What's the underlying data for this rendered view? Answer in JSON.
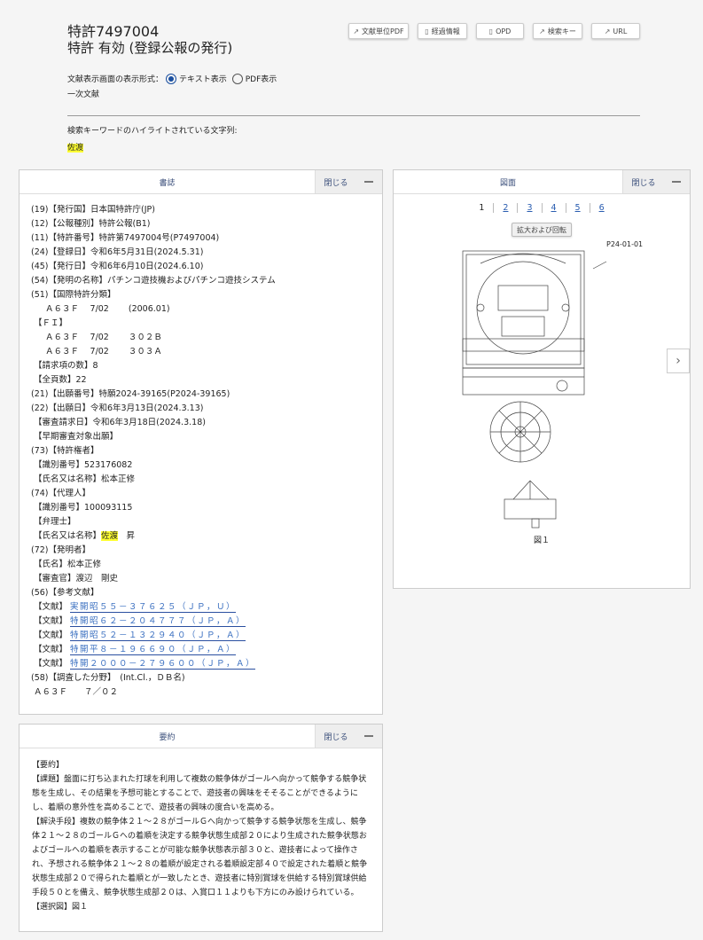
{
  "header": {
    "patent_no": "特許7497004",
    "status": "特許 有効 (登録公報の発行)"
  },
  "toolbar": [
    {
      "label": "文献単位PDF",
      "icon": "external-link-icon"
    },
    {
      "label": "経過情報",
      "icon": "document-icon"
    },
    {
      "label": "OPD",
      "icon": "document-icon"
    },
    {
      "label": "検索キー",
      "icon": "external-link-icon"
    },
    {
      "label": "URL",
      "icon": "external-link-icon"
    }
  ],
  "display_format": {
    "label": "文献表示画面の表示形式：",
    "options": [
      "テキスト表示",
      "PDF表示"
    ],
    "selected": "テキスト表示"
  },
  "primary_doc": "一次文献",
  "keyword": {
    "label": "検索キーワードのハイライトされている文字列:",
    "value": "佐渡"
  },
  "biblio": {
    "title": "書誌",
    "close": "閉じる",
    "lines": [
      "(19)【発行国】日本国特許庁(JP)",
      "(12)【公報種別】特許公報(B1)",
      "(11)【特許番号】特許第7497004号(P7497004)",
      "(24)【登録日】令和6年5月31日(2024.5.31)",
      "(45)【発行日】令和6年6月10日(2024.6.10)",
      "(54)【発明の名称】パチンコ遊技機およびパチンコ遊技システム",
      "(51)【国際特許分類】",
      "Ａ６３Ｆ　 7/02　　 (2006.01)",
      "【ＦＩ】",
      "Ａ６３Ｆ　 7/02　　 ３０２Ｂ",
      "Ａ６３Ｆ　 7/02　　 ３０３Ａ",
      "【請求項の数】8",
      "【全頁数】22",
      "(21)【出願番号】特願2024-39165(P2024-39165)",
      "(22)【出願日】令和6年3月13日(2024.3.13)",
      "【審査請求日】令和6年3月18日(2024.3.18)",
      "【早期審査対象出願】",
      "(73)【特許権者】",
      "【識別番号】523176082",
      "【氏名又は名称】松本正修",
      "(74)【代理人】",
      "【識別番号】100093115",
      "【弁理士】"
    ],
    "agent_name_label": "【氏名又は名称】",
    "agent_name_hl": "佐渡",
    "agent_name_rest": "昇",
    "lines2": [
      "(72)【発明者】",
      "【氏名】松本正修",
      "【審査官】渡辺　剛史",
      "(56)【参考文献】"
    ],
    "ref_label": "【文献】",
    "refs": [
      "実開昭５５－３７６２５（ＪＰ，Ｕ）",
      "特開昭６２－２０４７７７（ＪＰ，Ａ）",
      "特開昭５２－１３２９４０（ＪＰ，Ａ）",
      "特開平８－１９６６９０（ＪＰ，Ａ）",
      "特開２０００－２７９６００（ＪＰ，Ａ）"
    ],
    "lines3": [
      "(58)【調査した分野】　(Int.Cl.，ＤＢ名)",
      "Ａ６３Ｆ　　７／０２"
    ]
  },
  "drawings": {
    "title": "図面",
    "close": "閉じる",
    "pages": [
      "1",
      "2",
      "3",
      "4",
      "5",
      "6"
    ],
    "current_page": "1",
    "zoom_button": "拡大および回転",
    "fig_id": "P24-01-01",
    "caption": "図１"
  },
  "abstract": {
    "title": "要約",
    "close": "閉じる",
    "paras": [
      "【要約】",
      "【課題】盤面に打ち込まれた打球を利用して複数の競争体がゴールへ向かって競争する競争状態を生成し、その結果を予想可能とすることで、遊技者の興味をそそることができるようにし、着順の意外性を高めることで、遊技者の興味の度合いを高める。",
      "【解決手段】複数の競争体２１～２８がゴールＧへ向かって競争する競争状態を生成し、競争体２１～２８のゴールＧへの着順を決定する競争状態生成部２０により生成された競争状態およびゴールへの着順を表示することが可能な競争状態表示部３０と、遊技者によって操作され、予想される競争体２１～２８の着順が設定される着順設定部４０で設定された着順と競争状態生成部２０で得られた着順とが一致したとき、遊技者に特別賞球を供給する特別賞球供給手段５０とを備え、競争状態生成部２０は、入賞口１１よりも下方にのみ設けられている。",
      "【選択図】図１"
    ]
  }
}
